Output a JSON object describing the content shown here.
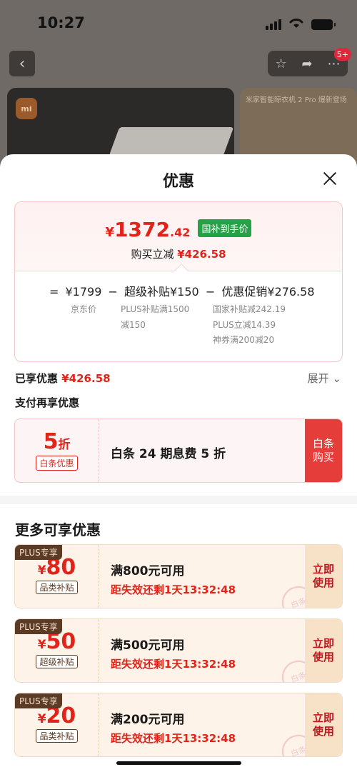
{
  "status": {
    "time": "10:27"
  },
  "background": {
    "badge": "5+",
    "brand_logo": "mi",
    "right_image_text": "米家智能晾衣机 2 Pro 爆新登场"
  },
  "sheet": {
    "title": "优惠",
    "price": {
      "yen": "¥",
      "integer": "1372",
      "decimal": ".42",
      "tag": "国补到手价"
    },
    "saving": {
      "label": "购买立减",
      "value": "¥426.58"
    },
    "formula": {
      "eq": "=",
      "base": "¥1799",
      "minus1": "−",
      "super_subsidy": "超级补贴¥150",
      "minus2": "−",
      "promo": "优惠促销¥276.58",
      "base_note": "京东价",
      "super_note_1": "PLUS补贴满1500",
      "super_note_2": "减150",
      "promo_note_1": "国家补贴减242.19",
      "promo_note_2": "PLUS立减14.39",
      "promo_note_3": "神券满200减20"
    },
    "enjoyed": {
      "label": "已享优惠",
      "value": "¥426.58"
    },
    "expand_label": "展开 ⌄",
    "pay_title": "支付再享优惠",
    "baitiao": {
      "discount_num": "5",
      "discount_unit": "折",
      "tag": "白条优惠",
      "text": "白条 24 期息费 5 折",
      "buy_line1": "白条",
      "buy_line2": "购买"
    },
    "more_title": "更多可享优惠",
    "coupons": [
      {
        "plus": "PLUS专享",
        "yen": "¥",
        "amount": "80",
        "category": "品类补贴",
        "condition": "满800元可用",
        "expire": "距失效还剩1天13:32:48",
        "use1": "立即",
        "use2": "使用",
        "stamp": "白条"
      },
      {
        "plus": "PLUS专享",
        "yen": "¥",
        "amount": "50",
        "category": "超级补贴",
        "condition": "满500元可用",
        "expire": "距失效还剩1天13:32:48",
        "use1": "立即",
        "use2": "使用",
        "stamp": "白条"
      },
      {
        "plus": "PLUS专享",
        "yen": "¥",
        "amount": "20",
        "category": "品类补贴",
        "condition": "满200元可用",
        "expire": "距失效还剩1天13:32:48",
        "use1": "立即",
        "use2": "使用",
        "stamp": "白条"
      }
    ]
  },
  "colors": {
    "accent_red": "#e2231a",
    "green_tag": "#25a146",
    "coupon_bg": "#fdf3e8"
  }
}
